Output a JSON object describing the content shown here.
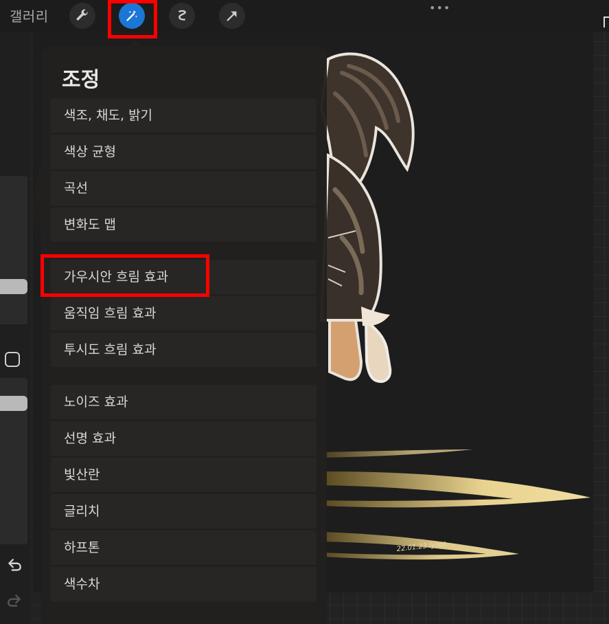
{
  "topbar": {
    "gallery_label": "갤러리",
    "tools": [
      {
        "name": "wrench-icon"
      },
      {
        "name": "magic-wand-icon",
        "active": true
      },
      {
        "name": "selection-icon"
      },
      {
        "name": "transform-arrow-icon"
      }
    ],
    "more_label": "•••"
  },
  "panel": {
    "title": "조정",
    "group1": [
      "색조, 채도, 밝기",
      "색상 균형",
      "곡선",
      "변화도 맵"
    ],
    "group2": [
      "가우시안 흐림 효과",
      "움직임 흐림 효과",
      "투시도 흐림 효과"
    ],
    "group3": [
      "노이즈 효과",
      "선명 효과",
      "빛산란",
      "글리치",
      "하프톤",
      "색수차"
    ]
  },
  "canvas": {
    "signature": "22.01.23 lyoot."
  },
  "colors": {
    "accent": "#1b76d6",
    "highlight": "#ff0000",
    "panel_bg": "#22201e",
    "item_bg": "#282624"
  }
}
